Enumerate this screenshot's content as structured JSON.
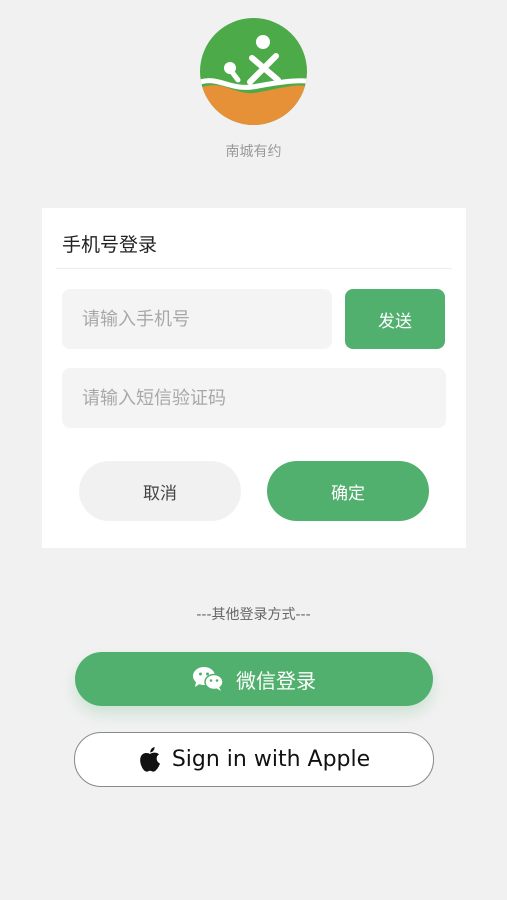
{
  "app": {
    "name": "南城有约"
  },
  "login_card": {
    "title": "手机号登录",
    "phone_placeholder": "请输入手机号",
    "code_placeholder": "请输入短信验证码",
    "send_label": "发送",
    "cancel_label": "取消",
    "confirm_label": "确定"
  },
  "other_login": {
    "divider_text": "---其他登录方式---",
    "wechat_label": "微信登录",
    "apple_label": "Sign in with Apple"
  },
  "colors": {
    "accent": "#52b06f",
    "logo_green": "#4caa48",
    "logo_orange": "#e69038",
    "background": "#f1f1f1"
  }
}
